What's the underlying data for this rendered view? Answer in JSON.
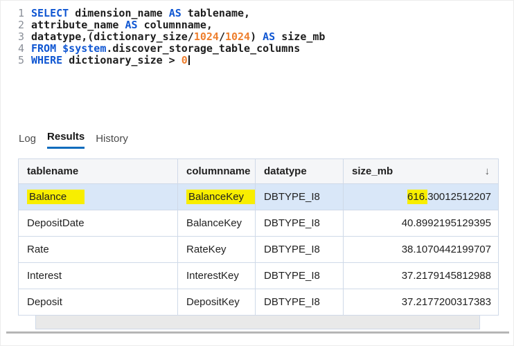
{
  "colors": {
    "keyword": "#0f56d2",
    "number": "#ee7f2e",
    "plain": "#1d1d1d",
    "line-number": "#8a8f98",
    "highlight": "#f8ee00",
    "selection": "#d9e7f8",
    "tab-accent": "#0f6cbd",
    "grid": "#cfd9e8",
    "header-bg": "#f5f6f8"
  },
  "editor": {
    "lines": [
      {
        "number": "1",
        "segments": [
          {
            "type": "keyword",
            "text": "SELECT "
          },
          {
            "type": "plain",
            "text": "dimension_name "
          },
          {
            "type": "keyword",
            "text": "AS "
          },
          {
            "type": "plain",
            "text": "tablename,"
          }
        ]
      },
      {
        "number": "2",
        "segments": [
          {
            "type": "plain",
            "text": "attribute_name "
          },
          {
            "type": "keyword",
            "text": "AS "
          },
          {
            "type": "plain",
            "text": "columnname,"
          }
        ]
      },
      {
        "number": "3",
        "segments": [
          {
            "type": "plain",
            "text": "datatype,(dictionary_size/"
          },
          {
            "type": "number",
            "text": "1024"
          },
          {
            "type": "plain",
            "text": "/"
          },
          {
            "type": "number",
            "text": "1024"
          },
          {
            "type": "plain",
            "text": ") "
          },
          {
            "type": "keyword",
            "text": "AS "
          },
          {
            "type": "plain",
            "text": "size_mb"
          }
        ]
      },
      {
        "number": "4",
        "segments": [
          {
            "type": "keyword",
            "text": "FROM "
          },
          {
            "type": "keyword",
            "text": "$system"
          },
          {
            "type": "plain",
            "text": ".discover_storage_table_columns"
          }
        ]
      },
      {
        "number": "5",
        "cursor": true,
        "segments": [
          {
            "type": "keyword",
            "text": "WHERE "
          },
          {
            "type": "plain",
            "text": "dictionary_size > "
          },
          {
            "type": "number",
            "text": "0"
          }
        ]
      }
    ]
  },
  "tabs": [
    {
      "label": "Log",
      "active": false
    },
    {
      "label": "Results",
      "active": true
    },
    {
      "label": "History",
      "active": false
    }
  ],
  "table": {
    "columns": [
      {
        "label": "tablename"
      },
      {
        "label": "columnname"
      },
      {
        "label": "datatype"
      },
      {
        "label": "size_mb",
        "sort": "desc"
      }
    ],
    "sort_icon": "↓",
    "rows": [
      {
        "selected": true,
        "cells": [
          {
            "col": "tablename",
            "parts": [
              {
                "text": "Balance",
                "hl": true
              }
            ]
          },
          {
            "col": "columnname",
            "parts": [
              {
                "text": "BalanceKey",
                "hl": true
              }
            ]
          },
          {
            "col": "datatype",
            "parts": [
              {
                "text": "DBTYPE_I8"
              }
            ]
          },
          {
            "col": "size_mb",
            "parts": [
              {
                "text": "616.",
                "hl": true
              },
              {
                "text": "30012512207"
              }
            ]
          }
        ]
      },
      {
        "selected": false,
        "cells": [
          {
            "col": "tablename",
            "parts": [
              {
                "text": "DepositDate"
              }
            ]
          },
          {
            "col": "columnname",
            "parts": [
              {
                "text": "BalanceKey"
              }
            ]
          },
          {
            "col": "datatype",
            "parts": [
              {
                "text": "DBTYPE_I8"
              }
            ]
          },
          {
            "col": "size_mb",
            "parts": [
              {
                "text": "40.8992195129395"
              }
            ]
          }
        ]
      },
      {
        "selected": false,
        "cells": [
          {
            "col": "tablename",
            "parts": [
              {
                "text": "Rate"
              }
            ]
          },
          {
            "col": "columnname",
            "parts": [
              {
                "text": "RateKey"
              }
            ]
          },
          {
            "col": "datatype",
            "parts": [
              {
                "text": "DBTYPE_I8"
              }
            ]
          },
          {
            "col": "size_mb",
            "parts": [
              {
                "text": "38.1070442199707"
              }
            ]
          }
        ]
      },
      {
        "selected": false,
        "cells": [
          {
            "col": "tablename",
            "parts": [
              {
                "text": "Interest"
              }
            ]
          },
          {
            "col": "columnname",
            "parts": [
              {
                "text": "InterestKey"
              }
            ]
          },
          {
            "col": "datatype",
            "parts": [
              {
                "text": "DBTYPE_I8"
              }
            ]
          },
          {
            "col": "size_mb",
            "parts": [
              {
                "text": "37.2179145812988"
              }
            ]
          }
        ]
      },
      {
        "selected": false,
        "cells": [
          {
            "col": "tablename",
            "parts": [
              {
                "text": "Deposit"
              }
            ]
          },
          {
            "col": "columnname",
            "parts": [
              {
                "text": "DepositKey"
              }
            ]
          },
          {
            "col": "datatype",
            "parts": [
              {
                "text": "DBTYPE_I8"
              }
            ]
          },
          {
            "col": "size_mb",
            "parts": [
              {
                "text": "37.2177200317383"
              }
            ]
          }
        ]
      }
    ]
  }
}
